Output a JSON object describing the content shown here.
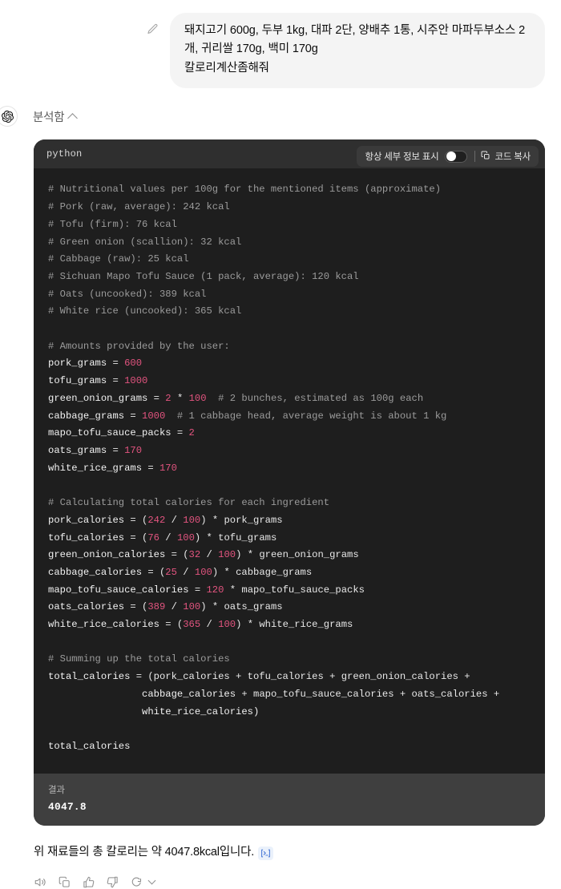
{
  "user_message": {
    "text": "돼지고기 600g, 두부 1kg, 대파 2단, 양배추 1통, 시주안 마파두부소스 2개, 귀리쌀 170g, 백미 170g\n칼로리계산좀해줘",
    "edit_icon": "pencil-icon"
  },
  "assistant": {
    "avatar_icon": "openai-logo-icon",
    "analysis_label": "분석함",
    "analysis_chevron": "chevron-up-icon"
  },
  "code_block": {
    "language": "python",
    "toolbar": {
      "always_show_details_label": "항상 세부 정보 표시",
      "toggle_state": "off",
      "copy_label": "코드 복사",
      "copy_icon": "copy-icon"
    },
    "lines": [
      {
        "t": "comment",
        "s": "# Nutritional values per 100g for the mentioned items (approximate)"
      },
      {
        "t": "comment",
        "s": "# Pork (raw, average): 242 kcal"
      },
      {
        "t": "comment",
        "s": "# Tofu (firm): 76 kcal"
      },
      {
        "t": "comment",
        "s": "# Green onion (scallion): 32 kcal"
      },
      {
        "t": "comment",
        "s": "# Cabbage (raw): 25 kcal"
      },
      {
        "t": "comment",
        "s": "# Sichuan Mapo Tofu Sauce (1 pack, average): 120 kcal"
      },
      {
        "t": "comment",
        "s": "# Oats (uncooked): 389 kcal"
      },
      {
        "t": "comment",
        "s": "# White rice (uncooked): 365 kcal"
      },
      {
        "t": "blank",
        "s": ""
      },
      {
        "t": "comment",
        "s": "# Amounts provided by the user:"
      },
      {
        "t": "code",
        "parts": [
          [
            "name",
            "pork_grams"
          ],
          [
            "op",
            " = "
          ],
          [
            "num",
            "600"
          ]
        ]
      },
      {
        "t": "code",
        "parts": [
          [
            "name",
            "tofu_grams"
          ],
          [
            "op",
            " = "
          ],
          [
            "num",
            "1000"
          ]
        ]
      },
      {
        "t": "code",
        "parts": [
          [
            "name",
            "green_onion_grams"
          ],
          [
            "op",
            " = "
          ],
          [
            "num",
            "2"
          ],
          [
            "op",
            " * "
          ],
          [
            "num",
            "100"
          ],
          [
            "comment",
            "  # 2 bunches, estimated as 100g each"
          ]
        ]
      },
      {
        "t": "code",
        "parts": [
          [
            "name",
            "cabbage_grams"
          ],
          [
            "op",
            " = "
          ],
          [
            "num",
            "1000"
          ],
          [
            "comment",
            "  # 1 cabbage head, average weight is about 1 kg"
          ]
        ]
      },
      {
        "t": "code",
        "parts": [
          [
            "name",
            "mapo_tofu_sauce_packs"
          ],
          [
            "op",
            " = "
          ],
          [
            "num",
            "2"
          ]
        ]
      },
      {
        "t": "code",
        "parts": [
          [
            "name",
            "oats_grams"
          ],
          [
            "op",
            " = "
          ],
          [
            "num",
            "170"
          ]
        ]
      },
      {
        "t": "code",
        "parts": [
          [
            "name",
            "white_rice_grams"
          ],
          [
            "op",
            " = "
          ],
          [
            "num",
            "170"
          ]
        ]
      },
      {
        "t": "blank",
        "s": ""
      },
      {
        "t": "comment",
        "s": "# Calculating total calories for each ingredient"
      },
      {
        "t": "code",
        "parts": [
          [
            "name",
            "pork_calories"
          ],
          [
            "op",
            " = ("
          ],
          [
            "num",
            "242"
          ],
          [
            "op",
            " / "
          ],
          [
            "num",
            "100"
          ],
          [
            "op",
            ") * pork_grams"
          ]
        ]
      },
      {
        "t": "code",
        "parts": [
          [
            "name",
            "tofu_calories"
          ],
          [
            "op",
            " = ("
          ],
          [
            "num",
            "76"
          ],
          [
            "op",
            " / "
          ],
          [
            "num",
            "100"
          ],
          [
            "op",
            ") * tofu_grams"
          ]
        ]
      },
      {
        "t": "code",
        "parts": [
          [
            "name",
            "green_onion_calories"
          ],
          [
            "op",
            " = ("
          ],
          [
            "num",
            "32"
          ],
          [
            "op",
            " / "
          ],
          [
            "num",
            "100"
          ],
          [
            "op",
            ") * green_onion_grams"
          ]
        ]
      },
      {
        "t": "code",
        "parts": [
          [
            "name",
            "cabbage_calories"
          ],
          [
            "op",
            " = ("
          ],
          [
            "num",
            "25"
          ],
          [
            "op",
            " / "
          ],
          [
            "num",
            "100"
          ],
          [
            "op",
            ") * cabbage_grams"
          ]
        ]
      },
      {
        "t": "code",
        "parts": [
          [
            "name",
            "mapo_tofu_sauce_calories"
          ],
          [
            "op",
            " = "
          ],
          [
            "num",
            "120"
          ],
          [
            "op",
            " * mapo_tofu_sauce_packs"
          ]
        ]
      },
      {
        "t": "code",
        "parts": [
          [
            "name",
            "oats_calories"
          ],
          [
            "op",
            " = ("
          ],
          [
            "num",
            "389"
          ],
          [
            "op",
            " / "
          ],
          [
            "num",
            "100"
          ],
          [
            "op",
            ") * oats_grams"
          ]
        ]
      },
      {
        "t": "code",
        "parts": [
          [
            "name",
            "white_rice_calories"
          ],
          [
            "op",
            " = ("
          ],
          [
            "num",
            "365"
          ],
          [
            "op",
            " / "
          ],
          [
            "num",
            "100"
          ],
          [
            "op",
            ") * white_rice_grams"
          ]
        ]
      },
      {
        "t": "blank",
        "s": ""
      },
      {
        "t": "comment",
        "s": "# Summing up the total calories"
      },
      {
        "t": "code",
        "parts": [
          [
            "name",
            "total_calories"
          ],
          [
            "op",
            " = (pork_calories + tofu_calories + green_onion_calories +"
          ]
        ]
      },
      {
        "t": "code",
        "parts": [
          [
            "op",
            "                "
          ],
          [
            "name",
            "cabbage_calories"
          ],
          [
            "op",
            " + mapo_tofu_sauce_calories + oats_calories +"
          ]
        ]
      },
      {
        "t": "code",
        "parts": [
          [
            "op",
            "                "
          ],
          [
            "name",
            "white_rice_calories)"
          ]
        ]
      },
      {
        "t": "blank",
        "s": ""
      },
      {
        "t": "code",
        "parts": [
          [
            "name",
            "total_calories"
          ]
        ]
      }
    ],
    "result": {
      "label": "결과",
      "value": "4047.8"
    }
  },
  "final_answer": {
    "text": "위 재료들의 총 칼로리는 약 4047.8kcal입니다.",
    "citation_icon": "terminal-citation-icon"
  },
  "action_bar": {
    "items": [
      {
        "icon": "speaker-icon",
        "name": "read-aloud-button"
      },
      {
        "icon": "copy-icon",
        "name": "copy-button"
      },
      {
        "icon": "thumbs-up-icon",
        "name": "thumbs-up-button"
      },
      {
        "icon": "thumbs-down-icon",
        "name": "thumbs-down-button"
      },
      {
        "icon": "regenerate-icon",
        "name": "regenerate-button"
      },
      {
        "icon": "chevron-down-icon",
        "name": "model-switch-button"
      }
    ]
  },
  "colors": {
    "user_bubble_bg": "#f4f4f4",
    "code_bg": "#1e1e1e",
    "code_head_bg": "#2f2f2f",
    "result_bg": "#3f3f3f",
    "number_token": "#e2547f",
    "comment_token": "#9b9b9b",
    "citation_bg": "#eaf1fb"
  }
}
